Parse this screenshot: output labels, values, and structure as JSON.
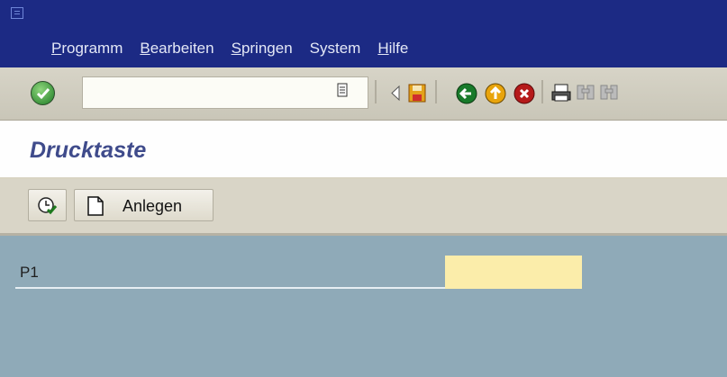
{
  "menubar": {
    "items": [
      {
        "mnemonic": "P",
        "rest": "rogramm"
      },
      {
        "mnemonic": "B",
        "rest": "earbeiten"
      },
      {
        "mnemonic": "S",
        "rest": "pringen"
      },
      {
        "mnemonic": "",
        "rest": "System"
      },
      {
        "mnemonic": "H",
        "rest": "ilfe"
      }
    ]
  },
  "toolbar": {
    "command_value": "",
    "icons": [
      "enter-icon",
      "dropdown-icon",
      "back-arrow-icon",
      "save-icon",
      "back-icon",
      "exit-icon",
      "cancel-icon",
      "print-icon",
      "find-icon",
      "find-next-icon"
    ]
  },
  "title": {
    "text": "Drucktaste"
  },
  "app_toolbar": {
    "create_label": "Anlegen",
    "icons": [
      "execute-icon",
      "create-document-icon"
    ]
  },
  "form": {
    "p1_label": "P1",
    "p1_value": ""
  },
  "colors": {
    "menubar": "#1c2a84",
    "content": "#8faab8",
    "input": "#fbedaa",
    "title": "#3f4b8b"
  }
}
